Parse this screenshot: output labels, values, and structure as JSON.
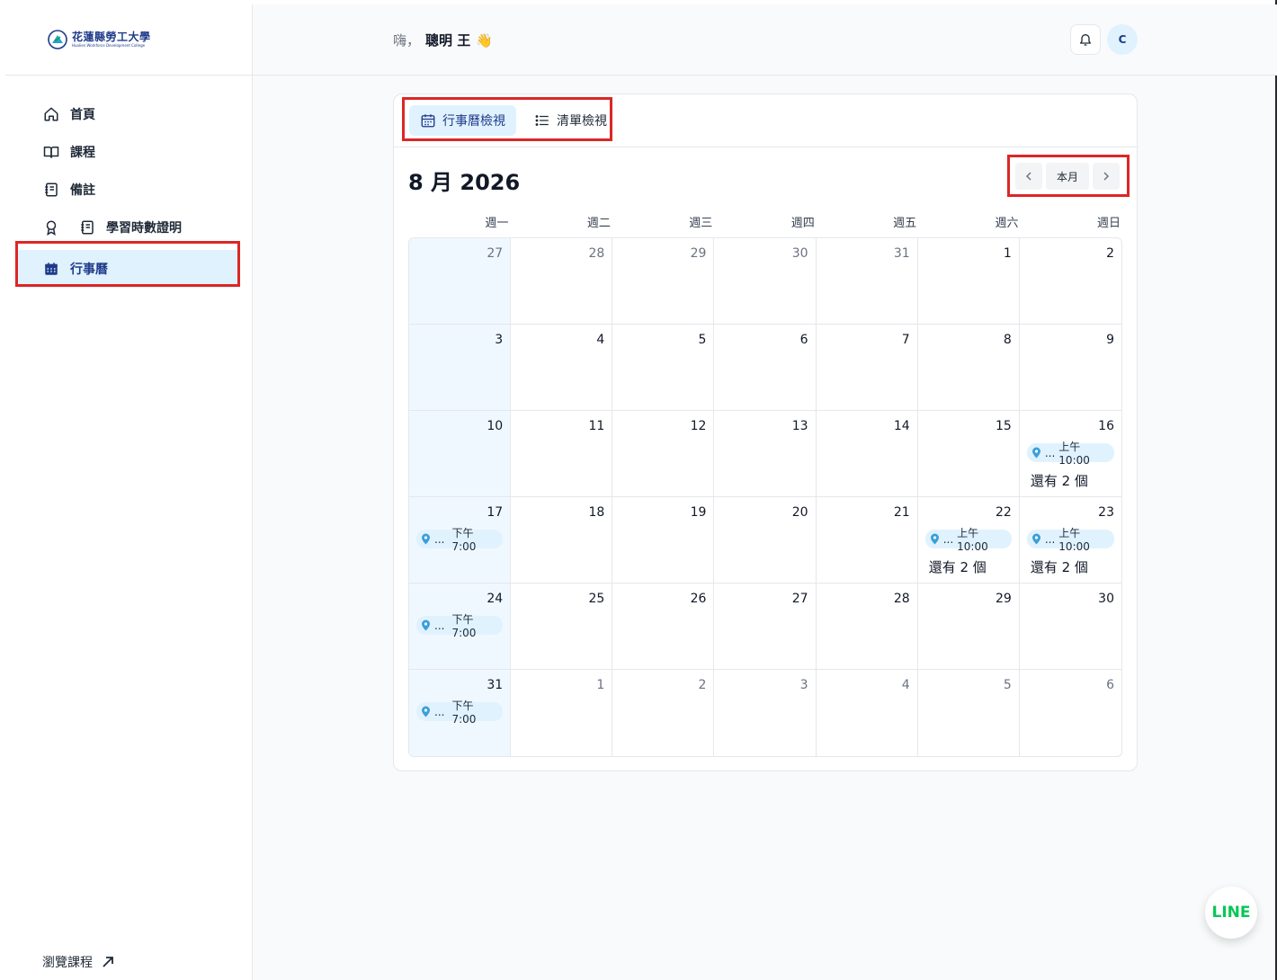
{
  "logo": {
    "name_cn": "花蓮縣勞工大學",
    "name_en": "Hualien Workforce Development College"
  },
  "sidebar": {
    "items": [
      {
        "label": "首頁",
        "icon": "home-icon"
      },
      {
        "label": "課程",
        "icon": "book-open-icon"
      },
      {
        "label": "備註",
        "icon": "notebook-icon"
      },
      {
        "label": "學習時數證明",
        "icon": "notebook-icon"
      },
      {
        "label": "行事曆",
        "icon": "calendar-icon",
        "active": true
      }
    ],
    "browse_label": "瀏覽課程"
  },
  "header": {
    "greeting": "嗨，",
    "user_name": "聰明 王",
    "wave": "👋",
    "avatar_initial": "C"
  },
  "view_tabs": {
    "calendar": "行事曆檢視",
    "list": "清單檢視"
  },
  "calendar": {
    "month_title": "8 月 2026",
    "today_label": "本月",
    "weekdays": [
      "週一",
      "週二",
      "週三",
      "週四",
      "週五",
      "週六",
      "週日"
    ],
    "days": [
      {
        "n": "27",
        "muted": true
      },
      {
        "n": "28",
        "muted": true
      },
      {
        "n": "29",
        "muted": true
      },
      {
        "n": "30",
        "muted": true
      },
      {
        "n": "31",
        "muted": true
      },
      {
        "n": "1"
      },
      {
        "n": "2"
      },
      {
        "n": "3"
      },
      {
        "n": "4"
      },
      {
        "n": "5"
      },
      {
        "n": "6"
      },
      {
        "n": "7"
      },
      {
        "n": "8"
      },
      {
        "n": "9"
      },
      {
        "n": "10"
      },
      {
        "n": "11"
      },
      {
        "n": "12"
      },
      {
        "n": "13"
      },
      {
        "n": "14"
      },
      {
        "n": "15"
      },
      {
        "n": "16",
        "event": {
          "title": "...",
          "time": "上午 10:00"
        },
        "more": "還有 2 個"
      },
      {
        "n": "17",
        "event": {
          "title": "...",
          "time": "下午 7:00"
        }
      },
      {
        "n": "18"
      },
      {
        "n": "19"
      },
      {
        "n": "20"
      },
      {
        "n": "21"
      },
      {
        "n": "22",
        "event": {
          "title": "...",
          "time": "上午 10:00"
        },
        "more": "還有 2 個"
      },
      {
        "n": "23",
        "event": {
          "title": "...",
          "time": "上午 10:00"
        },
        "more": "還有 2 個"
      },
      {
        "n": "24",
        "event": {
          "title": "...",
          "time": "下午 7:00"
        }
      },
      {
        "n": "25"
      },
      {
        "n": "26"
      },
      {
        "n": "27"
      },
      {
        "n": "28"
      },
      {
        "n": "29"
      },
      {
        "n": "30"
      },
      {
        "n": "31",
        "event": {
          "title": "...",
          "time": "下午 7:00"
        }
      },
      {
        "n": "1",
        "muted": true
      },
      {
        "n": "2",
        "muted": true
      },
      {
        "n": "3",
        "muted": true
      },
      {
        "n": "4",
        "muted": true
      },
      {
        "n": "5",
        "muted": true
      },
      {
        "n": "6",
        "muted": true
      }
    ]
  },
  "line_button": {
    "label": "LINE"
  },
  "colors": {
    "accent": "#1e3a8a",
    "active_bg": "#e0f2fe",
    "highlight": "#dc2626",
    "line_green": "#06c755"
  }
}
